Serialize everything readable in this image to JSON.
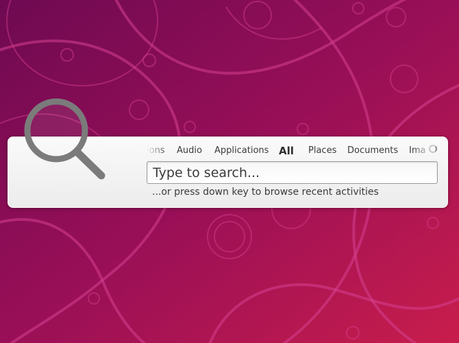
{
  "desktop": {
    "wallpaper_colors": [
      "#7a0a55",
      "#9a0f5a",
      "#c81e4e"
    ],
    "overlay_color": "#d63a8e"
  },
  "launcher": {
    "icon": "magnifier-icon",
    "tabs": [
      {
        "label": "Conversations",
        "visible_text": "ions",
        "active": false
      },
      {
        "label": "Audio",
        "active": false
      },
      {
        "label": "Applications",
        "active": false
      },
      {
        "label": "All",
        "active": true
      },
      {
        "label": "Places",
        "active": false
      },
      {
        "label": "Documents",
        "active": false
      },
      {
        "label": "Images",
        "visible_text": "Ima",
        "active": false
      }
    ],
    "search": {
      "value": "",
      "placeholder": "Type to search..."
    },
    "hint": "...or press down key to browse recent activities",
    "spinner_icon": "busy-spinner-icon"
  }
}
